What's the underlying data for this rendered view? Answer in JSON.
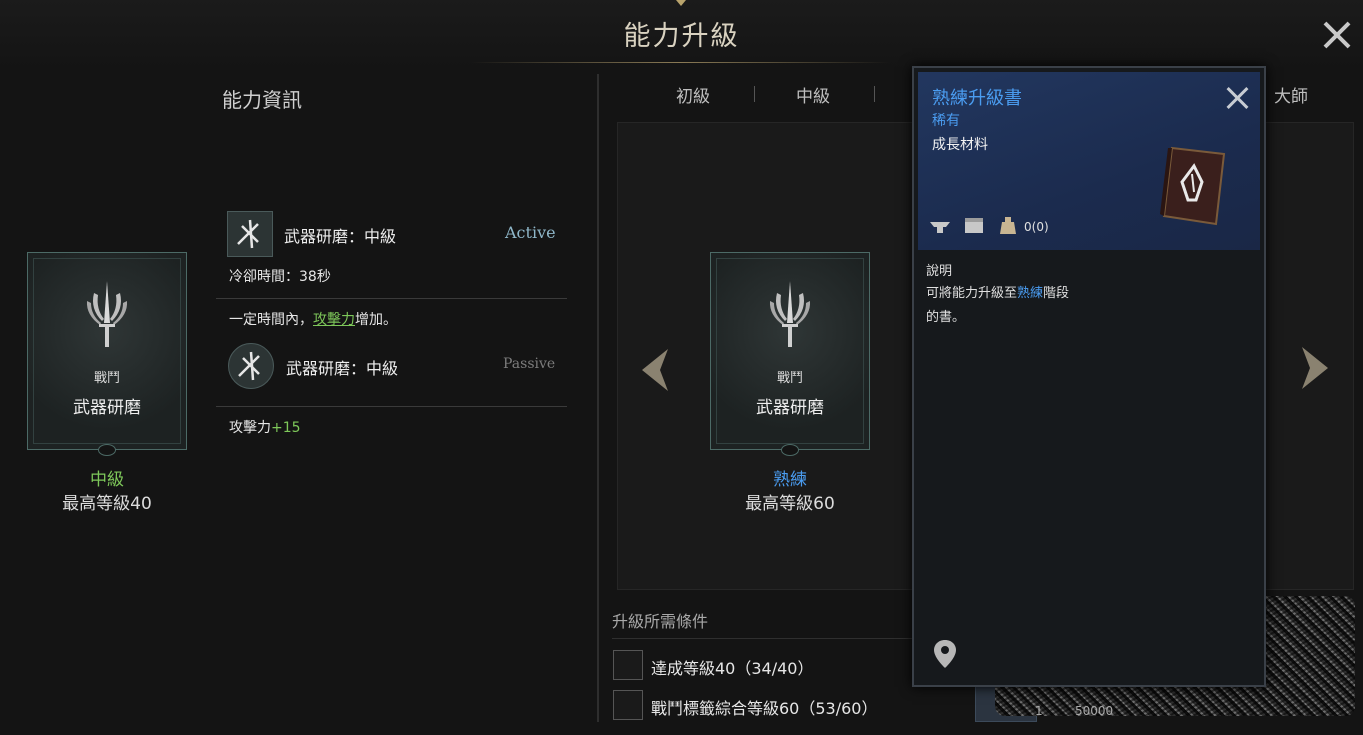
{
  "window": {
    "title": "能力升級"
  },
  "left": {
    "section_title": "能力資訊",
    "card": {
      "category": "戰鬥",
      "name": "武器研磨",
      "tier": "中級",
      "max_level": "最高等級40"
    },
    "active_skill": {
      "name": "武器研磨：中級",
      "type": "Active",
      "cooldown": "冷卻時間：38秒"
    },
    "effect": {
      "prefix": "一定時間內，",
      "keyword": "攻擊力",
      "suffix": "增加。"
    },
    "passive_skill": {
      "name": "武器研磨：中級",
      "type": "Passive"
    },
    "stat": {
      "label": "攻擊力",
      "value": "+15"
    }
  },
  "tabs": [
    "初級",
    "中級",
    "大師"
  ],
  "right": {
    "card": {
      "category": "戰鬥",
      "name": "武器研磨",
      "tier": "熟練",
      "max_level": "最高等級60"
    },
    "requirements_title": "升級所需條件",
    "requirements": [
      "達成等級40（34/40）",
      "戰鬥標籤綜合等級60（53/60）"
    ]
  },
  "tooltip": {
    "title": "熟練升級書",
    "rarity": "稀有",
    "type": "成長材料",
    "count": "0(0)",
    "desc_title": "說明",
    "desc_prefix": "可將能力升級至",
    "desc_keyword": "熟練",
    "desc_suffix": "階段",
    "desc_line2": "的書。"
  },
  "peek": {
    "qty": "1",
    "cost": "50000"
  },
  "colors": {
    "green": "#7ec85a",
    "blue": "#4a9cf0",
    "active": "#8fb7c9",
    "passive": "#7c7c7c"
  }
}
